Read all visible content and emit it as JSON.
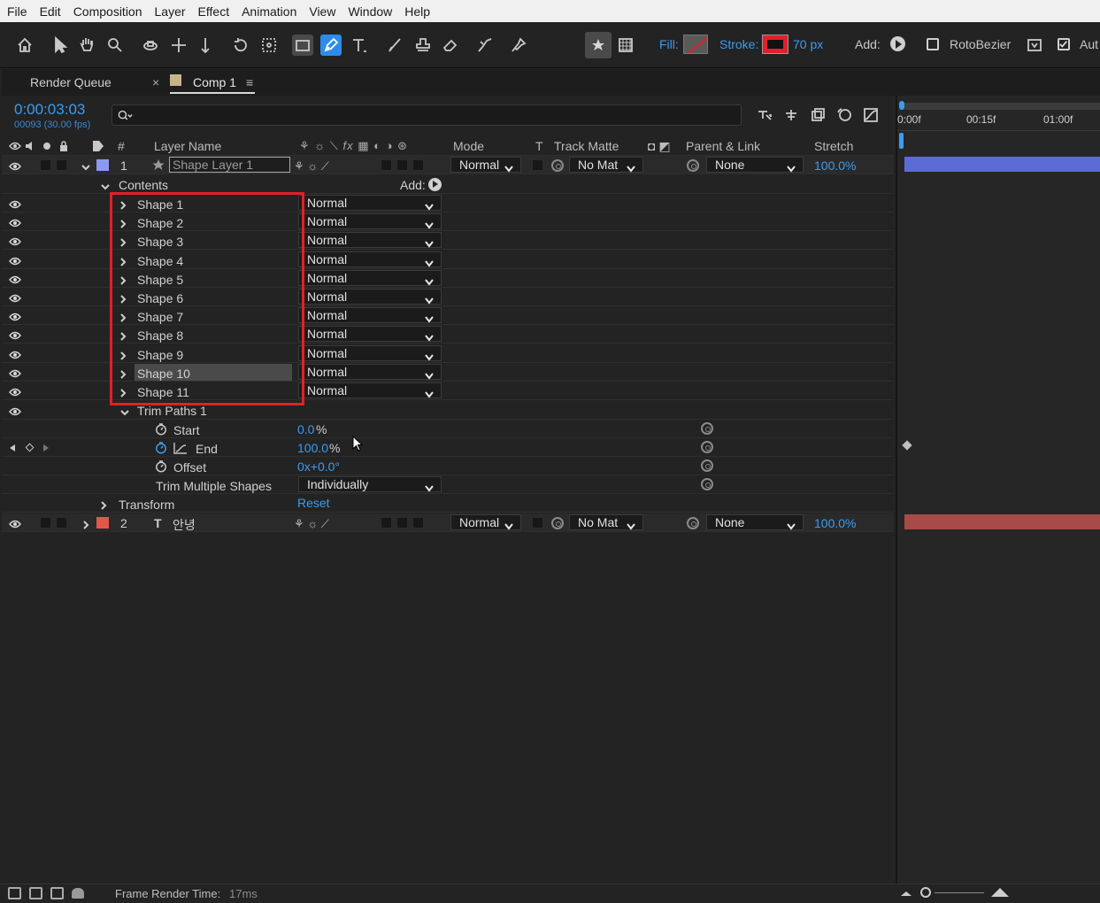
{
  "menu": [
    "File",
    "Edit",
    "Composition",
    "Layer",
    "Effect",
    "Animation",
    "View",
    "Window",
    "Help"
  ],
  "toolbar": {
    "fill_label": "Fill:",
    "stroke_label": "Stroke:",
    "stroke_width": "70 px",
    "add_label": "Add:",
    "rotobezier_label": "RotoBezier",
    "auto_label": "Aut"
  },
  "tabs": {
    "render_queue": "Render Queue",
    "close": "×",
    "comp": "Comp 1",
    "menu": "≡"
  },
  "timecode": "0:00:03:03",
  "frames": "00093 (30.00 fps)",
  "ruler": [
    "0:00f",
    "00:15f",
    "01:00f"
  ],
  "headers": {
    "num": "#",
    "layer_name": "Layer Name",
    "mode": "Mode",
    "t": "T",
    "track_matte": "Track Matte",
    "parent": "Parent & Link",
    "stretch": "Stretch"
  },
  "layer1": {
    "num": "1",
    "name": "Shape Layer 1",
    "mode": "Normal",
    "matte": "No Mat",
    "parent": "None",
    "stretch": "100.0%",
    "label_color": "#8c9aef"
  },
  "contents": {
    "label": "Contents",
    "add": "Add:"
  },
  "shapes": [
    {
      "name": "Shape 1",
      "mode": "Normal"
    },
    {
      "name": "Shape 2",
      "mode": "Normal"
    },
    {
      "name": "Shape 3",
      "mode": "Normal"
    },
    {
      "name": "Shape 4",
      "mode": "Normal"
    },
    {
      "name": "Shape 5",
      "mode": "Normal"
    },
    {
      "name": "Shape 6",
      "mode": "Normal"
    },
    {
      "name": "Shape 7",
      "mode": "Normal"
    },
    {
      "name": "Shape 8",
      "mode": "Normal"
    },
    {
      "name": "Shape 9",
      "mode": "Normal"
    },
    {
      "name": "Shape 10",
      "mode": "Normal"
    },
    {
      "name": "Shape 11",
      "mode": "Normal"
    }
  ],
  "trim": {
    "label": "Trim Paths 1",
    "start_label": "Start",
    "start_value": "0.0",
    "start_unit": "%",
    "end_label": "End",
    "end_value": "100.0",
    "end_unit": "%",
    "offset_label": "Offset",
    "offset_value": "0x+0.0°",
    "multi_label": "Trim Multiple Shapes",
    "multi_value": "Individually"
  },
  "transform": {
    "label": "Transform",
    "reset": "Reset"
  },
  "layer2": {
    "num": "2",
    "type": "T",
    "name": "안녕",
    "mode": "Normal",
    "matte": "No Mat",
    "parent": "None",
    "stretch": "100.0%",
    "label_color": "#e0574c"
  },
  "status": {
    "label": "Frame Render Time:",
    "value": "17ms"
  },
  "colors": {
    "accent": "#2d8ceb",
    "highlight": "#e0202a",
    "layer1_bar": "#5b6bd6",
    "layer2_bar": "#a64b48"
  }
}
